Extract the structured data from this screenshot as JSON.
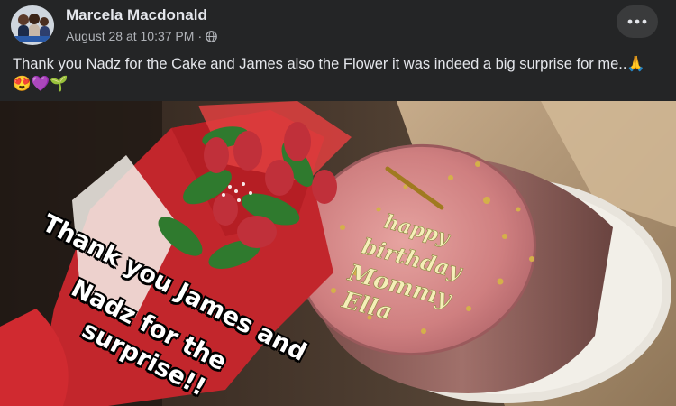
{
  "post": {
    "author": "Marcela Macdonald",
    "timestamp": "August 28 at 10:37 PM",
    "separator": "·",
    "audience_icon": "globe-icon",
    "more_icon": "more-options-icon",
    "caption_text": "Thank you Nadz for the Cake and James also the Flower it was indeed a big surprise for me..",
    "caption_emojis": [
      "🙏",
      "😍",
      "💜",
      "🌱"
    ]
  },
  "photo": {
    "overlay_lines": [
      "Thank you James and",
      "Nadz for the",
      "surprise!!"
    ],
    "cake_writing": [
      "happy",
      "birthday",
      "Mommy",
      "Ella"
    ]
  }
}
